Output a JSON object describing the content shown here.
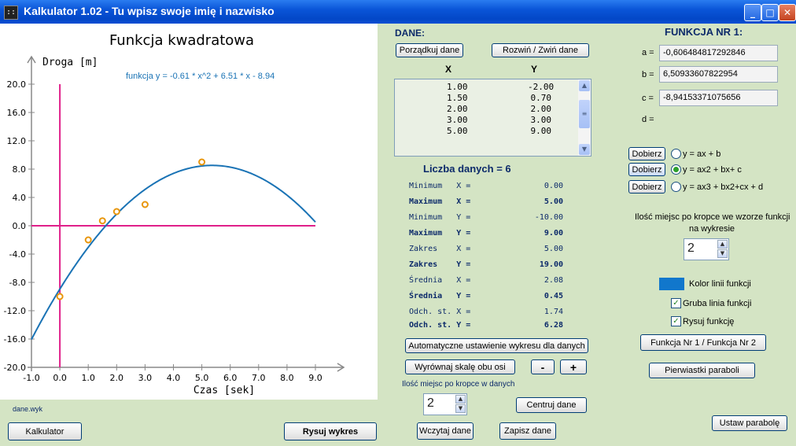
{
  "window": {
    "title": "Kalkulator 1.02 - Tu wpisz swoje imię i nazwisko",
    "icon_text": "::",
    "minimize": "_",
    "maximize": "□",
    "close": "✕"
  },
  "chart_data": {
    "type": "scatter",
    "title": "Funkcja kwadratowa",
    "ylabel": "Droga [m]",
    "xlabel": "Czas [sek]",
    "formula_label": "funkcja  y = -0.61 * x^2 + 6.51 * x - 8.94",
    "xlim": [
      -1.0,
      9.0
    ],
    "ylim": [
      -20.0,
      20.0
    ],
    "xticks": [
      "-1.0",
      "0.0",
      "1.0",
      "2.0",
      "3.0",
      "4.0",
      "5.0",
      "6.0",
      "7.0",
      "8.0",
      "9.0"
    ],
    "yticks": [
      "20.0",
      "16.0",
      "12.0",
      "8.0",
      "4.0",
      "0.0",
      "-4.0",
      "-8.0",
      "-12.0",
      "-16.0",
      "-20.0"
    ],
    "points": [
      {
        "x": 0.0,
        "y": -10.0
      },
      {
        "x": 1.0,
        "y": -2.0
      },
      {
        "x": 1.5,
        "y": 0.7
      },
      {
        "x": 2.0,
        "y": 2.0
      },
      {
        "x": 3.0,
        "y": 3.0
      },
      {
        "x": 5.0,
        "y": 9.0
      }
    ],
    "curve": {
      "a": -0.606484817292846,
      "b": 6.50933607822954,
      "c": -8.94153371075656
    },
    "colors": {
      "curve": "#1a73b5",
      "axes": "#e0208a",
      "points": "#e8960c",
      "frame": "#888888"
    }
  },
  "footer_left": {
    "filename": "dane.wyk",
    "calc_button": "Kalkulator",
    "draw_button": "Rysuj wykres"
  },
  "data_panel": {
    "heading": "DANE:",
    "sort_button": "Porządkuj dane",
    "expand_button": "Rozwiń / Zwiń  dane",
    "col_x": "X",
    "col_y": "Y",
    "rows": [
      {
        "x": "1.00",
        "y": "-2.00"
      },
      {
        "x": "1.50",
        "y": "0.70"
      },
      {
        "x": "2.00",
        "y": "2.00"
      },
      {
        "x": "3.00",
        "y": "3.00"
      },
      {
        "x": "5.00",
        "y": "9.00"
      }
    ],
    "count_label": "Liczba danych = 6",
    "stats": [
      {
        "label": "Minimum   X =",
        "value": "0.00",
        "bold": false
      },
      {
        "label": "Maximum   X =",
        "value": "5.00",
        "bold": true
      },
      {
        "label": "Minimum   Y =",
        "value": "-10.00",
        "bold": false
      },
      {
        "label": "Maximum   Y =",
        "value": "9.00",
        "bold": true
      },
      {
        "label": "Zakres    X =",
        "value": "5.00",
        "bold": false
      },
      {
        "label": "Zakres    Y =",
        "value": "19.00",
        "bold": true
      },
      {
        "label": "Średnia   X =",
        "value": "2.08",
        "bold": false
      },
      {
        "label": "Średnia   Y =",
        "value": "0.45",
        "bold": true
      },
      {
        "label": "Odch. st. X =",
        "value": "1.74",
        "bold": false
      },
      {
        "label": "Odch. st. Y =",
        "value": "6.28",
        "bold": true
      }
    ],
    "auto_button": "Automatyczne ustawienie wykresu dla danych",
    "align_button": "Wyrównaj skalę obu osi",
    "minus_button": "-",
    "plus_button": "+",
    "decimals_label": "Ilość miejsc po kropce w danych",
    "decimals_value": "2",
    "center_button": "Centruj dane",
    "load_button": "Wczytaj dane",
    "save_button": "Zapisz dane"
  },
  "function_panel": {
    "heading": "FUNKCJA NR 1:",
    "a_label": "a =",
    "a_value": "-0,606484817292846",
    "b_label": "b =",
    "b_value": "6,50933607822954",
    "c_label": "c =",
    "c_value": "-8,94153371075656",
    "d_label": "d =",
    "fit_button": "Dobierz",
    "options": [
      "y = ax + b",
      "y = ax2 + bx+ c",
      "y = ax3 + bx2+cx + d"
    ],
    "selected_option": 1,
    "decimals_label_1": "Ilość miejsc po kropce we wzorze funkcji",
    "decimals_label_2": "na wykresie",
    "decimals_value": "2",
    "color_label": "Kolor linii funkcji",
    "line_color": "#1177cc",
    "thick_label": "Gruba linia funkcji",
    "draw_fn_label": "Rysuj funkcję",
    "thick_checked": true,
    "draw_checked": true,
    "switch_button": "Funkcja Nr 1 /  Funkcja Nr 2",
    "roots_button": "Pierwiastki paraboli",
    "set_button": "Ustaw parabolę"
  }
}
